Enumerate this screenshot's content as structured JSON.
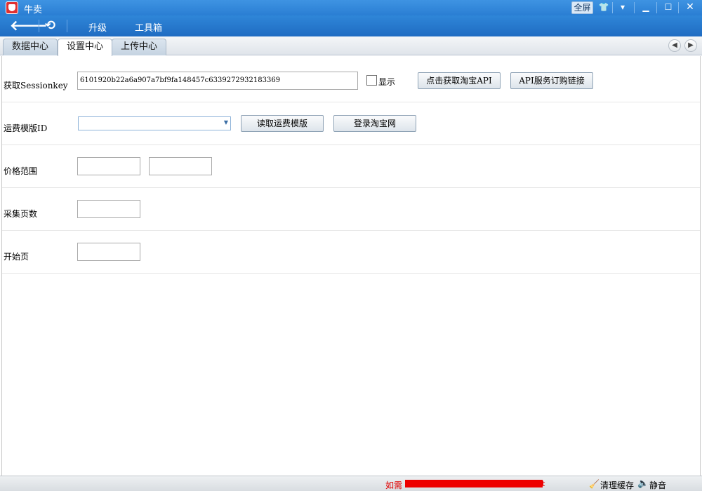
{
  "window": {
    "title": "牛卖",
    "fullscreen_label": "全屏",
    "icons": [
      "app-logo-icon",
      "shirt-icon",
      "menu-chevron-icon",
      "minimize-icon",
      "maximize-icon",
      "close-icon"
    ]
  },
  "toolbar": {
    "upgrade_label": "升级",
    "toolbox_label": "工具箱",
    "icons": [
      "back-arrow-icon",
      "refresh-icon"
    ]
  },
  "tabs": [
    {
      "label": "数据中心"
    },
    {
      "label": "设置中心"
    },
    {
      "label": "上传中心"
    }
  ],
  "form": {
    "session": {
      "label": "获取Sessionkey",
      "value": "6101920b22a6a907a7bf9fa148457c6339272932183369",
      "show_label": "显示",
      "show_checked": false,
      "get_api_button": "点击获取淘宝API",
      "api_link_button": "API服务订购链接"
    },
    "freight": {
      "label": "运费模版ID",
      "selected": "",
      "read_button": "读取运费模版",
      "login_button": "登录淘宝网"
    },
    "price": {
      "label": "价格范围",
      "min": "",
      "max": ""
    },
    "pages": {
      "label": "采集页数",
      "value": ""
    },
    "start_page": {
      "label": "开始页",
      "value": ""
    }
  },
  "statusbar": {
    "notice_prefix": "如需",
    "notice_suffix": "t",
    "clear_cache_label": "清理缓存",
    "mute_label": "静音",
    "notice_color": "#e00000"
  }
}
